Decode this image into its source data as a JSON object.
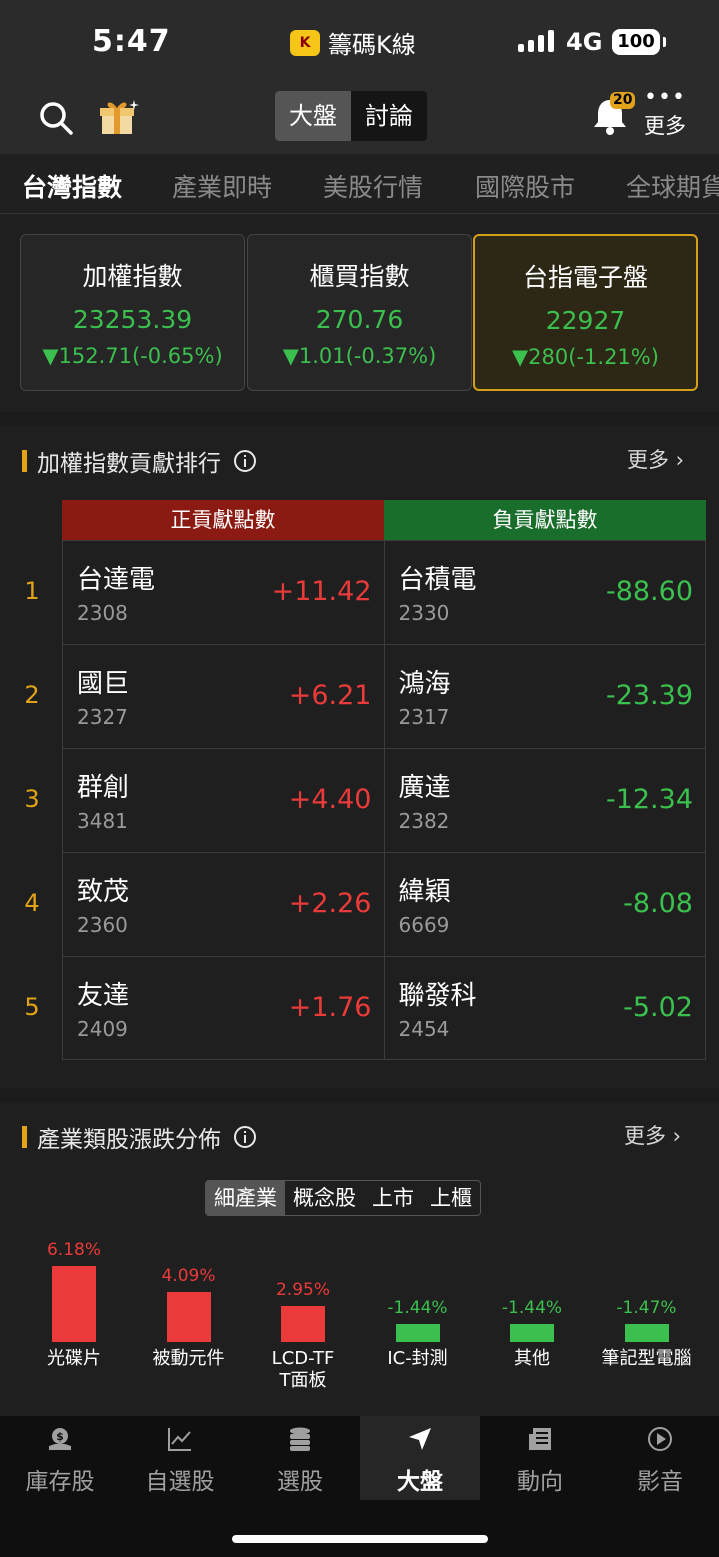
{
  "status": {
    "time": "5:47",
    "app_name": "籌碼K線",
    "app_icon_letter": "K",
    "network": "4G",
    "battery": "100"
  },
  "header": {
    "segments": [
      "大盤",
      "討論"
    ],
    "active_segment": "大盤",
    "notification_count": "20",
    "more_label": "更多"
  },
  "tabs": [
    "台灣指數",
    "產業即時",
    "美股行情",
    "國際股市",
    "全球期貨"
  ],
  "index_cards": [
    {
      "name": "加權指數",
      "value": "23253.39",
      "change": "▼152.71(-0.65%)"
    },
    {
      "name": "櫃買指數",
      "value": "270.76",
      "change": "▼1.01(-0.37%)"
    },
    {
      "name": "台指電子盤",
      "value": "22927",
      "change": "▼280(-1.21%)"
    }
  ],
  "contribution": {
    "title": "加權指數貢獻排行",
    "more": "更多",
    "pos_header": "正貢獻點數",
    "neg_header": "負貢獻點數",
    "rows": [
      {
        "rank": "1",
        "pos_name": "台達電",
        "pos_code": "2308",
        "pos_pts": "+11.42",
        "neg_name": "台積電",
        "neg_code": "2330",
        "neg_pts": "-88.60"
      },
      {
        "rank": "2",
        "pos_name": "國巨",
        "pos_code": "2327",
        "pos_pts": "+6.21",
        "neg_name": "鴻海",
        "neg_code": "2317",
        "neg_pts": "-23.39"
      },
      {
        "rank": "3",
        "pos_name": "群創",
        "pos_code": "3481",
        "pos_pts": "+4.40",
        "neg_name": "廣達",
        "neg_code": "2382",
        "neg_pts": "-12.34"
      },
      {
        "rank": "4",
        "pos_name": "致茂",
        "pos_code": "2360",
        "pos_pts": "+2.26",
        "neg_name": "緯穎",
        "neg_code": "6669",
        "neg_pts": "-8.08"
      },
      {
        "rank": "5",
        "pos_name": "友達",
        "pos_code": "2409",
        "pos_pts": "+1.76",
        "neg_name": "聯發科",
        "neg_code": "2454",
        "neg_pts": "-5.02"
      }
    ]
  },
  "sector": {
    "title": "產業類股漲跌分佈",
    "more": "更多",
    "filters": [
      "細產業",
      "概念股",
      "上市",
      "上櫃"
    ],
    "active_filter": "細產業",
    "items": [
      {
        "pct_label": "6.18%",
        "value": 6.18,
        "name": "光碟片"
      },
      {
        "pct_label": "4.09%",
        "value": 4.09,
        "name": "被動元件"
      },
      {
        "pct_label": "2.95%",
        "value": 2.95,
        "name": "LCD-TFT面板"
      },
      {
        "pct_label": "-1.44%",
        "value": -1.44,
        "name": "IC-封測"
      },
      {
        "pct_label": "-1.44%",
        "value": -1.44,
        "name": "其他"
      },
      {
        "pct_label": "-1.47%",
        "value": -1.47,
        "name": "筆記型電腦"
      }
    ]
  },
  "nav": [
    {
      "label": "庫存股",
      "icon": "money-bag-icon"
    },
    {
      "label": "自選股",
      "icon": "trend-chart-icon"
    },
    {
      "label": "選股",
      "icon": "database-icon"
    },
    {
      "label": "大盤",
      "icon": "navigation-arrow-icon"
    },
    {
      "label": "動向",
      "icon": "news-icon"
    },
    {
      "label": "影音",
      "icon": "play-circle-icon"
    }
  ],
  "active_nav": "大盤",
  "colors": {
    "up": "#ea3a3a",
    "down": "#3bbf4f",
    "accent": "#e2a316"
  }
}
